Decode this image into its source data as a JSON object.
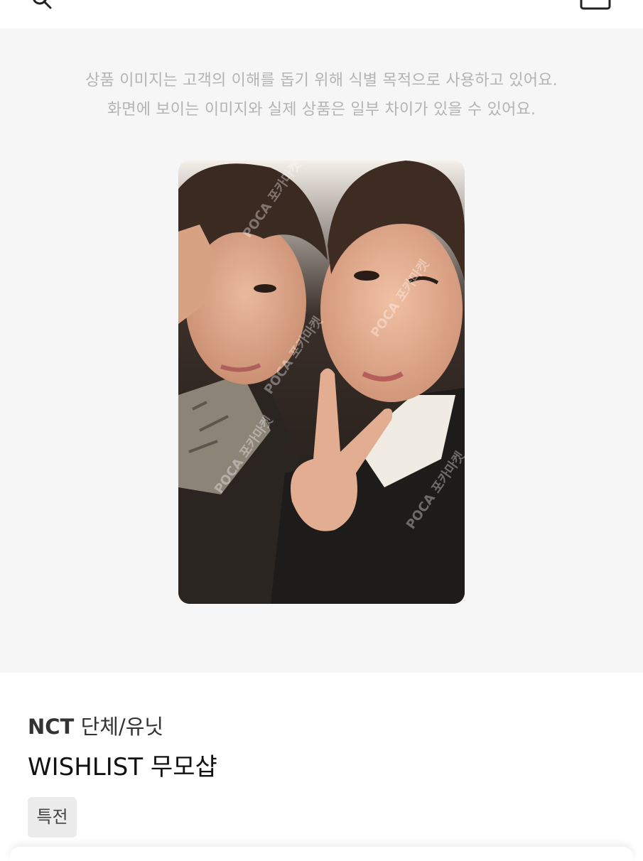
{
  "header": {
    "search_icon": "search-icon",
    "bag_icon": "shopping-bag-icon"
  },
  "image_notice": {
    "line1": "상품 이미지는 고객의 이해를 돕기 위해 식별 목적으로 사용하고 있어요.",
    "line2": "화면에 보이는 이미지와 실제 상품은 일부 차이가 있을 수 있어요."
  },
  "photo": {
    "watermark": "POCA 포카마켓",
    "colors": {
      "background": "#2a2320",
      "hair": "#3b2a22",
      "skin": "#d9a58a",
      "shirt": "#f1ece3",
      "jacket": "#1e1b1b",
      "scarf": "#8d8478"
    }
  },
  "product": {
    "group": "NCT",
    "category": "단체/유닛",
    "title": "WISHLIST 무모샵",
    "tag": "특전"
  }
}
